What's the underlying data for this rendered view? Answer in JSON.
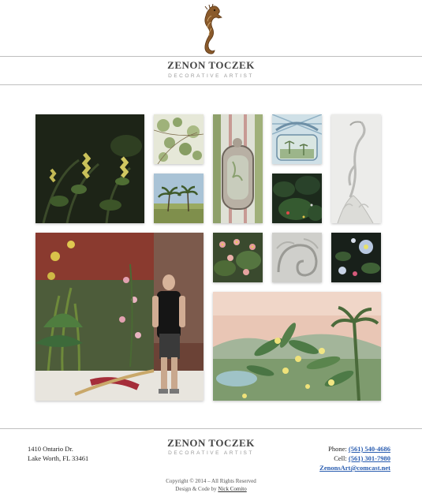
{
  "header": {
    "name": "ZENON TOCZEK",
    "subtitle": "DECORATIVE ARTIST",
    "logo_icon": "seahorse-icon"
  },
  "gallery": {
    "tiles": [
      "dark-botanical-panel",
      "eucalyptus-leaves",
      "trompe-loeil-panel",
      "tropical-lattice-mural",
      "white-heron-relief",
      "palm-landscape",
      "jungle-night",
      "artist-portrait-mural",
      "pink-flower-panel",
      "shell-relief",
      "white-flower-panel",
      "tropical-landscape-mural"
    ]
  },
  "footer": {
    "name": "ZENON TOCZEK",
    "subtitle": "DECORATIVE ARTIST",
    "address_line1": "1410 Ontario Dr.",
    "address_line2": "Lake Worth, FL 33461",
    "phone_label": "Phone:",
    "phone": "(561) 540-4686",
    "cell_label": "Cell:",
    "cell": "(561) 301-7980",
    "email": "ZenonsArt@comcast.net",
    "copyright": "Copyright © 2014 – All Rights Reserved",
    "credit_prefix": "Design & Code by",
    "credit_name": "Nick Comito"
  },
  "colors": {
    "link": "#2a5db0",
    "rule": "#bfbfbf",
    "title": "#444444",
    "subtitle": "#9a9a9a"
  }
}
